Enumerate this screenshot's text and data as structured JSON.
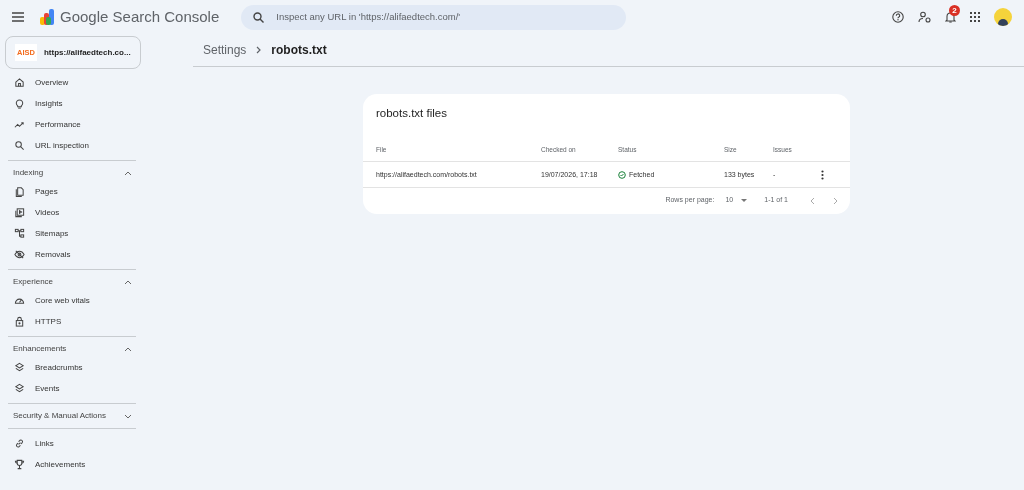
{
  "header": {
    "product": "Google Search Console",
    "search": {
      "placeholder": "Inspect any URL in 'https://alifaedtech.com/'"
    },
    "notification_count": "2"
  },
  "property": {
    "logo": "AISD",
    "url": "https://alifaedtech.co..."
  },
  "sidebar": {
    "groups": [
      {
        "items": [
          {
            "label": "Overview"
          },
          {
            "label": "Insights"
          },
          {
            "label": "Performance"
          },
          {
            "label": "URL inspection"
          }
        ]
      },
      {
        "title": "Indexing",
        "expanded": true,
        "items": [
          {
            "label": "Pages"
          },
          {
            "label": "Videos"
          },
          {
            "label": "Sitemaps"
          },
          {
            "label": "Removals"
          }
        ]
      },
      {
        "title": "Experience",
        "expanded": true,
        "items": [
          {
            "label": "Core web vitals"
          },
          {
            "label": "HTTPS"
          }
        ]
      },
      {
        "title": "Enhancements",
        "expanded": true,
        "items": [
          {
            "label": "Breadcrumbs"
          },
          {
            "label": "Events"
          }
        ]
      },
      {
        "title": "Security & Manual Actions",
        "expanded": false
      },
      {
        "items": [
          {
            "label": "Links"
          },
          {
            "label": "Achievements"
          }
        ]
      }
    ]
  },
  "breadcrumb": [
    "Settings",
    "robots.txt"
  ],
  "card": {
    "title": "robots.txt files",
    "table": {
      "columns": [
        "File",
        "Checked on",
        "Status",
        "Size",
        "Issues"
      ],
      "rows": [
        {
          "file": "https://alifaedtech.com/robots.txt",
          "checked_on": "19/07/2026, 17:18",
          "status": "Fetched",
          "size": "133 bytes",
          "issues": "-"
        }
      ]
    },
    "pagination": {
      "rows_per_page_label": "Rows per page:",
      "rows_per_page": "10",
      "range": "1-1 of 1"
    }
  }
}
